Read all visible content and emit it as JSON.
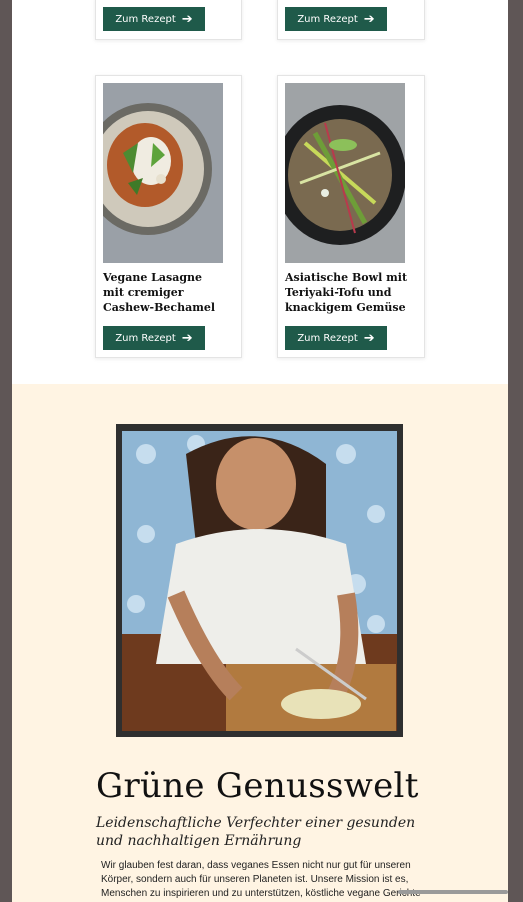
{
  "recipes_top": [
    {
      "button_label": "Zum Rezept"
    },
    {
      "button_label": "Zum Rezept"
    }
  ],
  "recipes": [
    {
      "title": "Vegane Lasagne mit cremiger Cashew-Bechamel",
      "button_label": "Zum Rezept"
    },
    {
      "title": "Asiatische Bowl mit Teriyaki-Tofu und knackigem Gemüse",
      "button_label": "Zum Rezept"
    }
  ],
  "about": {
    "title": "Grüne Genusswelt",
    "subtitle": "Leidenschaftliche Verfechter einer gesunden und nachhaltigen Ernährung",
    "body": "Wir glauben fest daran, dass veganes Essen nicht nur gut für unseren Körper, sondern auch für unseren Planeten ist. Unsere Mission ist es, Menschen zu inspirieren und zu unterstützen, köstliche vegane Gerichte"
  },
  "icons": {
    "button_arrow": "arrow-right-icon"
  },
  "colors": {
    "button": "#1f5a4a",
    "about_bg": "#fff4e3",
    "backdrop": "#5f5656"
  }
}
